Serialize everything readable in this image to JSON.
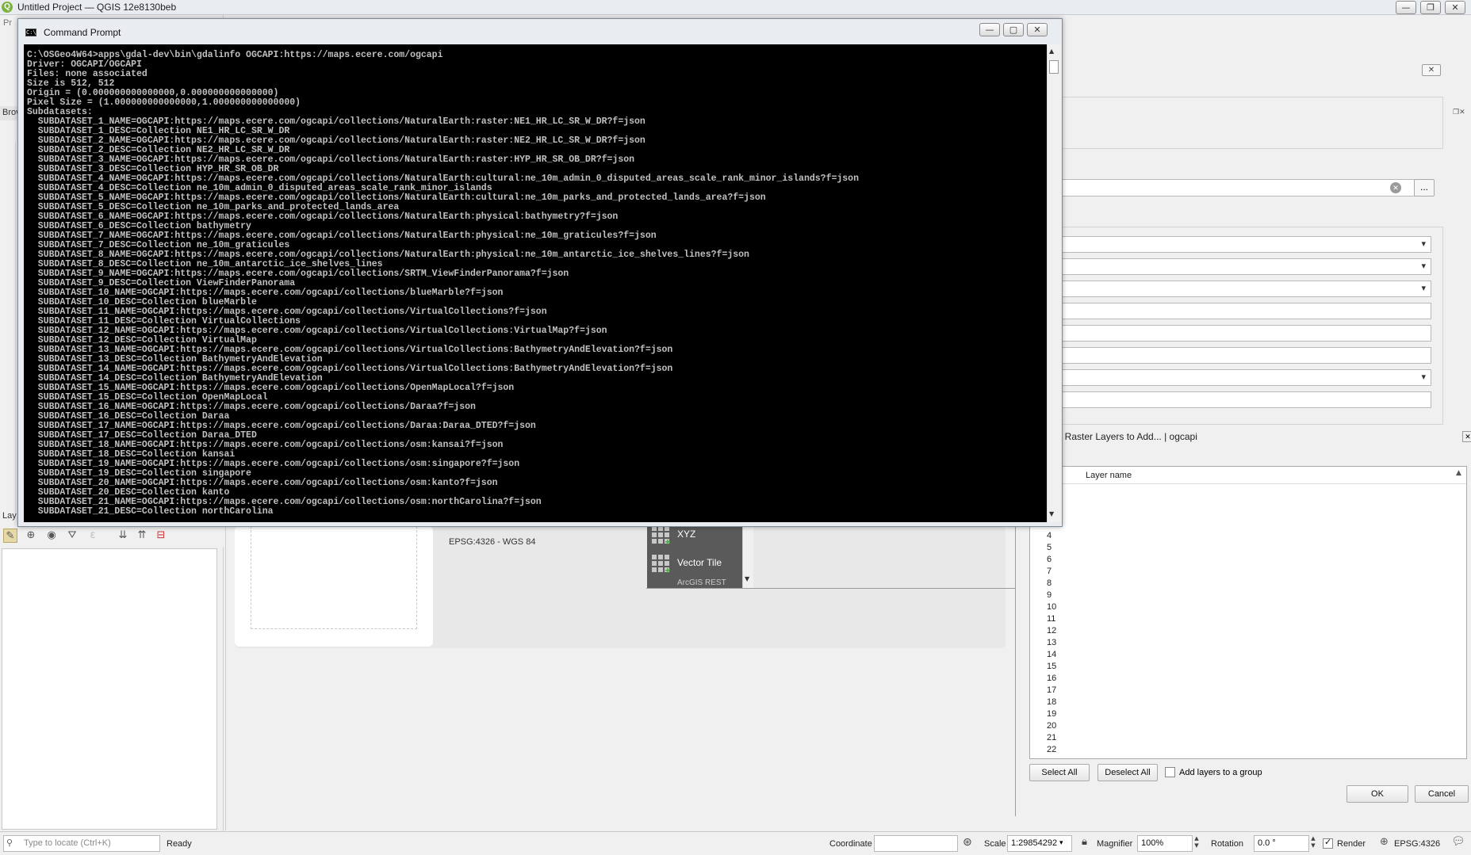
{
  "qgis": {
    "title": "Untitled Project — QGIS 12e8130beb",
    "menu_fragment": "Pr",
    "browser_fragment": "Brov",
    "layers_fragment": "Lay",
    "project_crs": "EPSG:4326 - WGS 84"
  },
  "cmd": {
    "title": "Command Prompt",
    "lines": [
      "C:\\OSGeo4W64>apps\\gdal-dev\\bin\\gdalinfo OGCAPI:https://maps.ecere.com/ogcapi",
      "Driver: OGCAPI/OGCAPI",
      "Files: none associated",
      "Size is 512, 512",
      "Origin = (0.000000000000000,0.000000000000000)",
      "Pixel Size = (1.000000000000000,1.000000000000000)",
      "Subdatasets:",
      "  SUBDATASET_1_NAME=OGCAPI:https://maps.ecere.com/ogcapi/collections/NaturalEarth:raster:NE1_HR_LC_SR_W_DR?f=json",
      "  SUBDATASET_1_DESC=Collection NE1_HR_LC_SR_W_DR",
      "  SUBDATASET_2_NAME=OGCAPI:https://maps.ecere.com/ogcapi/collections/NaturalEarth:raster:NE2_HR_LC_SR_W_DR?f=json",
      "  SUBDATASET_2_DESC=Collection NE2_HR_LC_SR_W_DR",
      "  SUBDATASET_3_NAME=OGCAPI:https://maps.ecere.com/ogcapi/collections/NaturalEarth:raster:HYP_HR_SR_OB_DR?f=json",
      "  SUBDATASET_3_DESC=Collection HYP_HR_SR_OB_DR",
      "  SUBDATASET_4_NAME=OGCAPI:https://maps.ecere.com/ogcapi/collections/NaturalEarth:cultural:ne_10m_admin_0_disputed_areas_scale_rank_minor_islands?f=json",
      "  SUBDATASET_4_DESC=Collection ne_10m_admin_0_disputed_areas_scale_rank_minor_islands",
      "  SUBDATASET_5_NAME=OGCAPI:https://maps.ecere.com/ogcapi/collections/NaturalEarth:cultural:ne_10m_parks_and_protected_lands_area?f=json",
      "  SUBDATASET_5_DESC=Collection ne_10m_parks_and_protected_lands_area",
      "  SUBDATASET_6_NAME=OGCAPI:https://maps.ecere.com/ogcapi/collections/NaturalEarth:physical:bathymetry?f=json",
      "  SUBDATASET_6_DESC=Collection bathymetry",
      "  SUBDATASET_7_NAME=OGCAPI:https://maps.ecere.com/ogcapi/collections/NaturalEarth:physical:ne_10m_graticules?f=json",
      "  SUBDATASET_7_DESC=Collection ne_10m_graticules",
      "  SUBDATASET_8_NAME=OGCAPI:https://maps.ecere.com/ogcapi/collections/NaturalEarth:physical:ne_10m_antarctic_ice_shelves_lines?f=json",
      "  SUBDATASET_8_DESC=Collection ne_10m_antarctic_ice_shelves_lines",
      "  SUBDATASET_9_NAME=OGCAPI:https://maps.ecere.com/ogcapi/collections/SRTM_ViewFinderPanorama?f=json",
      "  SUBDATASET_9_DESC=Collection ViewFinderPanorama",
      "  SUBDATASET_10_NAME=OGCAPI:https://maps.ecere.com/ogcapi/collections/blueMarble?f=json",
      "  SUBDATASET_10_DESC=Collection blueMarble",
      "  SUBDATASET_11_NAME=OGCAPI:https://maps.ecere.com/ogcapi/collections/VirtualCollections?f=json",
      "  SUBDATASET_11_DESC=Collection VirtualCollections",
      "  SUBDATASET_12_NAME=OGCAPI:https://maps.ecere.com/ogcapi/collections/VirtualCollections:VirtualMap?f=json",
      "  SUBDATASET_12_DESC=Collection VirtualMap",
      "  SUBDATASET_13_NAME=OGCAPI:https://maps.ecere.com/ogcapi/collections/VirtualCollections:BathymetryAndElevation?f=json",
      "  SUBDATASET_13_DESC=Collection BathymetryAndElevation",
      "  SUBDATASET_14_NAME=OGCAPI:https://maps.ecere.com/ogcapi/collections/VirtualCollections:BathymetryAndElevation?f=json",
      "  SUBDATASET_14_DESC=Collection BathymetryAndElevation",
      "  SUBDATASET_15_NAME=OGCAPI:https://maps.ecere.com/ogcapi/collections/OpenMapLocal?f=json",
      "  SUBDATASET_15_DESC=Collection OpenMapLocal",
      "  SUBDATASET_16_NAME=OGCAPI:https://maps.ecere.com/ogcapi/collections/Daraa?f=json",
      "  SUBDATASET_16_DESC=Collection Daraa",
      "  SUBDATASET_17_NAME=OGCAPI:https://maps.ecere.com/ogcapi/collections/Daraa:Daraa_DTED?f=json",
      "  SUBDATASET_17_DESC=Collection Daraa_DTED",
      "  SUBDATASET_18_NAME=OGCAPI:https://maps.ecere.com/ogcapi/collections/osm:kansai?f=json",
      "  SUBDATASET_18_DESC=Collection kansai",
      "  SUBDATASET_19_NAME=OGCAPI:https://maps.ecere.com/ogcapi/collections/osm:singapore?f=json",
      "  SUBDATASET_19_DESC=Collection singapore",
      "  SUBDATASET_20_NAME=OGCAPI:https://maps.ecere.com/ogcapi/collections/osm:kanto?f=json",
      "  SUBDATASET_20_DESC=Collection kanto",
      "  SUBDATASET_21_NAME=OGCAPI:https://maps.ecere.com/ogcapi/collections/osm:northCarolina?f=json",
      "  SUBDATASET_21_DESC=Collection northCarolina"
    ]
  },
  "connections": {
    "items": [
      {
        "label": "XYZ",
        "icon": "xyz-grid-icon"
      },
      {
        "label": "Vector Tile",
        "icon": "vector-tile-grid-icon"
      }
    ],
    "partial_label": "ArcGIS REST"
  },
  "raster_dialog": {
    "title": ": Raster Layers to Add... | ogcapi",
    "column_header": "Layer name",
    "row_numbers": [
      "4",
      "5",
      "6",
      "7",
      "8",
      "9",
      "10",
      "11",
      "12",
      "13",
      "14",
      "15",
      "16",
      "17",
      "18",
      "19",
      "20",
      "21",
      "22"
    ],
    "select_all": "Select All",
    "deselect_all": "Deselect All",
    "add_to_group": "Add layers to a group",
    "ok": "OK",
    "cancel": "Cancel"
  },
  "dsm": {
    "browse_button": "..."
  },
  "statusbar": {
    "locate_placeholder": "Type to locate (Ctrl+K)",
    "ready": "Ready",
    "coordinate_label": "Coordinate",
    "coordinate_value": "",
    "scale_label": "Scale",
    "scale_value": "1:29854292",
    "magnifier_label": "Magnifier",
    "magnifier_value": "100%",
    "rotation_label": "Rotation",
    "rotation_value": "0.0 °",
    "render_label": "Render",
    "render_checked": true,
    "crs": "EPSG:4326"
  },
  "colors": {
    "console_bg": "#000000",
    "console_text": "#c0c0c0",
    "menu_bg": "#5a5a5a"
  }
}
